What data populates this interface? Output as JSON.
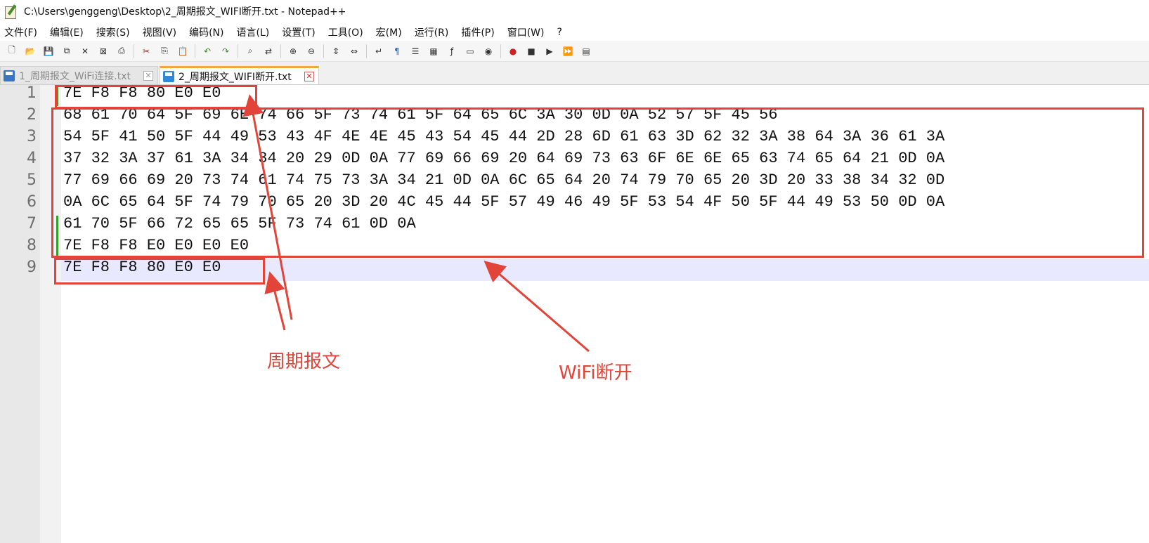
{
  "window": {
    "title": "C:\\Users\\genggeng\\Desktop\\2_周期报文_WIFI断开.txt - Notepad++"
  },
  "menu": [
    "文件(F)",
    "编辑(E)",
    "搜索(S)",
    "视图(V)",
    "编码(N)",
    "语言(L)",
    "设置(T)",
    "工具(O)",
    "宏(M)",
    "运行(R)",
    "插件(P)",
    "窗口(W)",
    "?"
  ],
  "toolbar_icons": [
    "new-file-icon",
    "open-file-icon",
    "save-icon",
    "save-all-icon",
    "close-icon",
    "close-all-icon",
    "print-icon",
    "|",
    "cut-icon",
    "copy-icon",
    "paste-icon",
    "|",
    "undo-icon",
    "redo-icon",
    "|",
    "find-icon",
    "replace-icon",
    "|",
    "zoom-in-icon",
    "zoom-out-icon",
    "|",
    "sync-vertical-icon",
    "sync-horizontal-icon",
    "|",
    "word-wrap-icon",
    "show-all-chars-icon",
    "indent-guide-icon",
    "doc-map-icon",
    "function-list-icon",
    "folder-workspace-icon",
    "monitor-icon",
    "|",
    "record-macro-icon",
    "stop-macro-icon",
    "play-macro-icon",
    "run-macro-multiple-icon",
    "save-macro-icon"
  ],
  "tabs": [
    {
      "label": "1_周期报文_WiFi连接.txt",
      "active": false
    },
    {
      "label": "2_周期报文_WIFI断开.txt",
      "active": true
    }
  ],
  "editor": {
    "line_numbers": [
      "1",
      "2",
      "3",
      "4",
      "5",
      "6",
      "7",
      "8",
      "9"
    ],
    "lines": [
      "7E F8 F8 80 E0 E0",
      "68 61 70 64 5F 69 6E 74 66 5F 73 74 61 5F 64 65 6C 3A 30 0D 0A 52 57 5F 45 56",
      "54 5F 41 50 5F 44 49 53 43 4F 4E 4E 45 43 54 45 44 2D 28 6D 61 63 3D 62 32 3A 38 64 3A 36 61 3A",
      "37 32 3A 37 61 3A 34 34 20 29 0D 0A 77 69 66 69 20 64 69 73 63 6F 6E 6E 65 63 74 65 64 21 0D 0A",
      "77 69 66 69 20 73 74 61 74 75 73 3A 34 21 0D 0A 6C 65 64 20 74 79 70 65 20 3D 20 33 38 34 32 0D",
      "0A 6C 65 64 5F 74 79 70 65 20 3D 20 4C 45 44 5F 57 49 46 49 5F 53 54 4F 50 5F 44 49 53 50 0D 0A",
      "61 70 5F 66 72 65 65 5F 73 74 61 0D 0A",
      "7E F8 F8 E0 E0 E0 E0",
      "7E F8 F8 80 E0 E0"
    ]
  },
  "annotations": {
    "periodic_label": "周期报文",
    "wifi_label": "WiFi断开"
  },
  "colors": {
    "annotation": "#e2443a",
    "active_tab_accent": "#f3a63c",
    "current_line": "#e8e8ff",
    "change_bar": "#33a02c"
  }
}
